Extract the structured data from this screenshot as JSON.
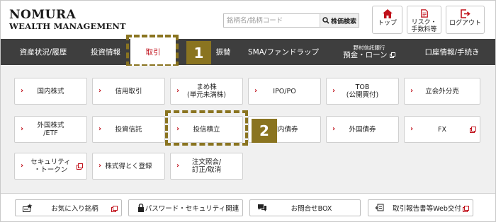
{
  "logo": {
    "line1": "NOMURA",
    "line2": "WEALTH MANAGEMENT"
  },
  "search": {
    "placeholder": "銘柄名/銘柄コード",
    "button_label": "株価検索"
  },
  "header_buttons": [
    {
      "label": "トップ",
      "icon": "home-icon"
    },
    {
      "label_line1": "リスク・",
      "label_line2": "手数料等",
      "icon": "document-icon"
    },
    {
      "label": "ログアウト",
      "icon": "logout-icon"
    }
  ],
  "nav": {
    "items": [
      {
        "label": "資産状況/履歴"
      },
      {
        "label": "投資情報"
      },
      {
        "label": "取引",
        "active": true
      },
      {
        "label": "振替"
      },
      {
        "label": "SMA/ファンドラップ"
      },
      {
        "label_small": "野村信託銀行",
        "label": "預金・ローン"
      },
      {
        "label": "口座情報/手続き"
      }
    ]
  },
  "callouts": {
    "one": "1",
    "two": "2"
  },
  "tiles": [
    {
      "label": "国内株式"
    },
    {
      "label": "信用取引"
    },
    {
      "line1": "まめ株",
      "line2": "(単元未満株)"
    },
    {
      "label": "IPO/PO"
    },
    {
      "line1": "TOB",
      "line2": "(公開買付)"
    },
    {
      "label": "立会外分売"
    },
    {
      "line1": "外国株式",
      "line2": "/ETF"
    },
    {
      "label": "投資信託"
    },
    {
      "label": "投信積立"
    },
    {
      "label": "国内債券"
    },
    {
      "label": "外国債券"
    },
    {
      "label": "FX",
      "external": true
    },
    {
      "line1": "セキュリティ",
      "line2": "・トークン",
      "external": true
    },
    {
      "label": "株式得とく登録"
    },
    {
      "line1": "注文照会/",
      "line2": "訂正/取消"
    }
  ],
  "bottom_buttons": [
    {
      "label": "お気に入り銘柄",
      "icon": "favorites-icon"
    },
    {
      "label": "パスワード・セキュリティ関連",
      "icon": "lock-icon"
    },
    {
      "label": "お問合せBOX",
      "icon": "chat-icon"
    },
    {
      "label": "取引報告書等Web交付",
      "icon": "web-delivery-icon"
    }
  ],
  "colors": {
    "brand_red": "#c0101a",
    "nav_bg": "#3e3e3e",
    "callout": "#8a7420",
    "content_bg": "#f0f0f0"
  }
}
